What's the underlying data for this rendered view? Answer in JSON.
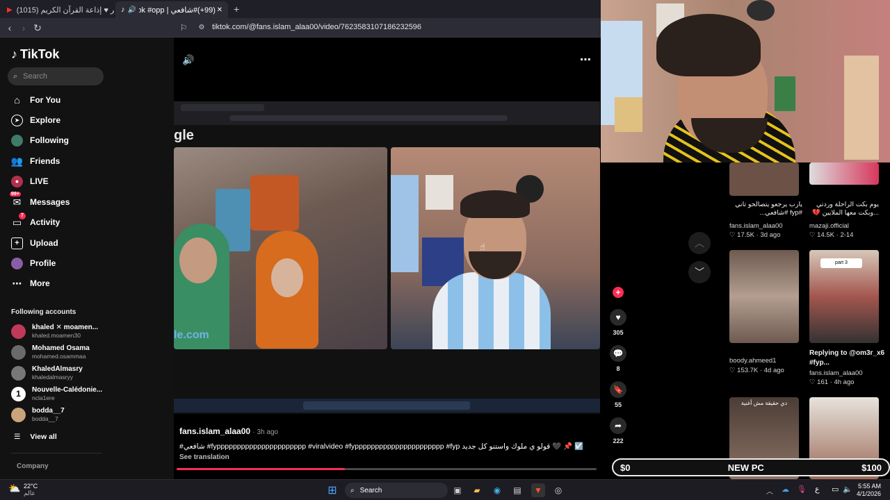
{
  "browser": {
    "tabs": [
      {
        "label": "(1015) بث مباشر ♥ إذاعة القرآن الكريم"
      },
      {
        "label": "(99+)#شافعي | TikTok #opp..."
      }
    ],
    "new_tab": "+",
    "close": "✕",
    "url": "tiktok.com/@fans.islam_alaa00/video/7623583107186232596"
  },
  "sidebar": {
    "logo": "TikTok",
    "search_placeholder": "Search",
    "nav": [
      {
        "label": "For You",
        "icon": "home-icon"
      },
      {
        "label": "Explore",
        "icon": "compass-icon"
      },
      {
        "label": "Following",
        "icon": "following-avatar-icon"
      },
      {
        "label": "Friends",
        "icon": "friends-icon"
      },
      {
        "label": "LIVE",
        "icon": "live-icon"
      },
      {
        "label": "Messages",
        "icon": "messages-icon",
        "badge": "99+"
      },
      {
        "label": "Activity",
        "icon": "activity-icon",
        "badge": "7"
      },
      {
        "label": "Upload",
        "icon": "upload-icon"
      },
      {
        "label": "Profile",
        "icon": "profile-avatar-icon"
      },
      {
        "label": "More",
        "icon": "more-icon"
      }
    ],
    "following_header": "Following accounts",
    "accounts": [
      {
        "name": "khaled ✕ moamen...",
        "handle": "khaled.moamen30",
        "color": "#c0395a"
      },
      {
        "name": "Mohamed Osama",
        "handle": "mohamed.osammaa",
        "color": "#6a6a6a"
      },
      {
        "name": "KhaledAlmasry",
        "handle": "khaledalmasryy",
        "color": "#777777"
      },
      {
        "name": "Nouvelle-Calédonie...",
        "handle": "ncla1ere",
        "color": "#ffffff",
        "glyph": "1"
      },
      {
        "name": "bodda__7",
        "handle": "bodda__7",
        "color": "#caa47a"
      }
    ],
    "view_all": "View all",
    "company": "Company"
  },
  "player": {
    "volume_icon": "volume-icon",
    "more_icon": "more-options-icon",
    "inner_site_fragment": "gle",
    "inner_site_fragment_bottom": "le.com",
    "author": "fans.islam_alaa00",
    "time": "· 3h ago",
    "description": "#شافعي #fypppppppppppppppppppppp #viralvideo #fypppppppppppppppppppppp #fyp قولو ي ملوك واستنو كل جديد 🖤 📌 ☑️",
    "see_translation": "See translation",
    "progress": 0.4
  },
  "actions": [
    {
      "name": "like",
      "icon": "heart-icon",
      "count": "305"
    },
    {
      "name": "comment",
      "icon": "comment-icon",
      "count": "8"
    },
    {
      "name": "save",
      "icon": "bookmark-icon",
      "count": "55"
    },
    {
      "name": "share",
      "icon": "share-icon",
      "count": "222"
    }
  ],
  "grid": [
    {
      "caption": "يارب يرجعو يتصالحو تاني #fyp #شافعي...",
      "author": "fans.islam_alaa00",
      "likes": "17.5K",
      "age": "3d ago"
    },
    {
      "caption": "يوم بكت الراحلة وردتي ...وبكت معها الملايين 💔",
      "author": "mazaji.official",
      "likes": "14.5K",
      "age": "2-14"
    },
    {
      "caption": "",
      "author": "boody.ahmeed1",
      "likes": "153.7K",
      "age": "4d ago"
    },
    {
      "caption": "Replying to @om3r_x6 #fyp...",
      "author": "fans.islam_alaa00",
      "likes": "161",
      "age": "4h ago",
      "thumb_label": "part 3"
    },
    {
      "caption": "",
      "author": "",
      "likes": "",
      "age": "",
      "thumb_label": "دي حقيقة مش أغنية"
    },
    {
      "caption": "",
      "author": "",
      "likes": "",
      "age": ""
    }
  ],
  "overlay": {
    "left": "$0",
    "middle": "NEW PC",
    "right": "$100"
  },
  "taskbar": {
    "weather_temp": "22°C",
    "weather_label": "عالم",
    "search": "Search",
    "lang": "ع",
    "time": "5:55 AM",
    "date": "4/1/2026"
  },
  "colors": {
    "accent": "#fe2c55",
    "sidebar_bg": "#121212",
    "chrome_bg": "#2c2c36"
  }
}
